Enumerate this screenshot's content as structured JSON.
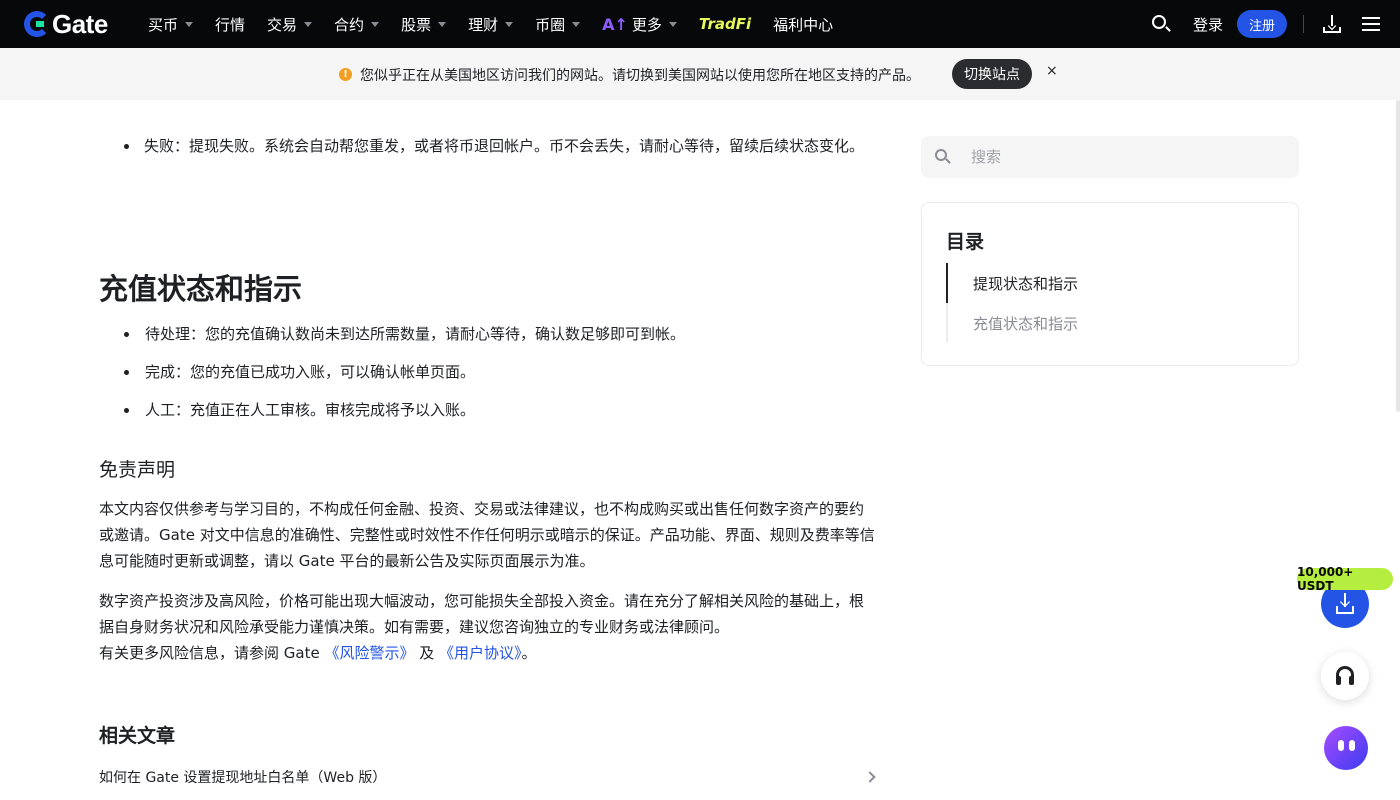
{
  "header": {
    "logo_text": "Gate",
    "nav": [
      {
        "label": "买币",
        "has_dropdown": true
      },
      {
        "label": "行情",
        "has_dropdown": false
      },
      {
        "label": "交易",
        "has_dropdown": true
      },
      {
        "label": "合约",
        "has_dropdown": true
      },
      {
        "label": "股票",
        "has_dropdown": true
      },
      {
        "label": "理财",
        "has_dropdown": true
      },
      {
        "label": "币圈",
        "has_dropdown": true
      },
      {
        "label": "更多",
        "has_dropdown": true
      }
    ],
    "tradfi_label": "TradFi",
    "welfare_label": "福利中心",
    "login_label": "登录",
    "signup_label": "注册",
    "accent_color": "#2354e6"
  },
  "notice": {
    "text": "您似乎正在从美国地区访问我们的网站。请切换到美国网站以使用您所在地区支持的产品。",
    "switch_label": "切换站点",
    "close_label": "×"
  },
  "article": {
    "withdraw_fail": "失败：提现失败。系统会自动帮您重发，或者将币退回帐户。币不会丢失，请耐心等待，留续后续状态变化。",
    "deposit_heading": "充值状态和指示",
    "deposit_items": [
      "待处理：您的充值确认数尚未到达所需数量，请耐心等待，确认数足够即可到帐。",
      "完成：您的充值已成功入账，可以确认帐单页面。",
      "人工：充值正在人工审核。审核完成将予以入账。"
    ],
    "disclaimer_heading": "免责声明",
    "disclaimer_p1": "本文内容仅供参考与学习目的，不构成任何金融、投资、交易或法律建议，也不构成购买或出售任何数字资产的要约或邀请。Gate 对文中信息的准确性、完整性或时效性不作任何明示或暗示的保证。产品功能、界面、规则及费率等信息可能随时更新或调整，请以 Gate 平台的最新公告及实际页面展示为准。",
    "disclaimer_p2": "数字资产投资涉及高风险，价格可能出现大幅波动，您可能损失全部投入资金。请在充分了解相关风险的基础上，根据自身财务状况和风险承受能力谨慎决策。如有需要，建议您咨询独立的专业财务或法律顾问。",
    "disclaimer_p3_prefix": "有关更多风险信息，请参阅 Gate ",
    "risk_link": "《风险警示》",
    "and_text": " 及 ",
    "terms_link": "《用户协议》",
    "period": "。",
    "related_heading": "相关文章",
    "related_items": [
      "如何在 Gate 设置提现地址白名单（Web 版）"
    ]
  },
  "sidebar": {
    "search_placeholder": "搜索",
    "toc_title": "目录",
    "toc_items": [
      "提现状态和指示",
      "充值状态和指示"
    ]
  },
  "floating": {
    "promo_badge": "10,000+ USDT"
  }
}
